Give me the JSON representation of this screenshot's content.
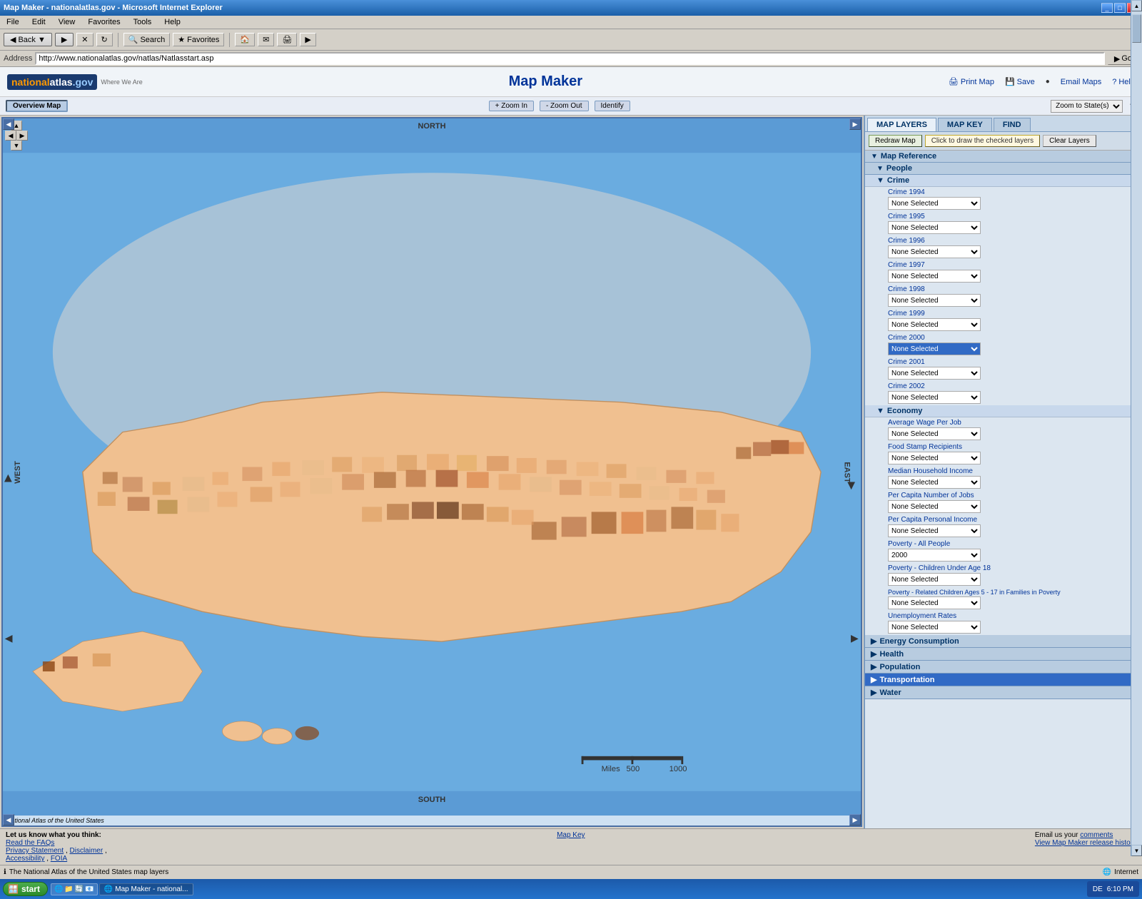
{
  "browser": {
    "title": "Map Maker - nationalatlas.gov - Microsoft Internet Explorer",
    "address": "http://www.nationalatlas.gov/natlas/Natlasstart.asp",
    "menu": [
      "File",
      "Edit",
      "View",
      "Favorites",
      "Tools",
      "Help"
    ],
    "back_label": "Back",
    "forward_label": "▶",
    "search_label": "Search",
    "favorites_label": "Favorites",
    "go_label": "Go",
    "address_label": "Address"
  },
  "app": {
    "logo_name": "nationalatlas.gov",
    "logo_sub": "Where We Are",
    "title": "Map Maker",
    "print_map": "Print Map",
    "save_label": "Save",
    "email_maps": "Email Maps",
    "help_label": "Help"
  },
  "map_toolbar": {
    "overview_map": "Overview Map",
    "zoom_in": "+ Zoom In",
    "zoom_out": "- Zoom Out",
    "identify": "Identify",
    "zoom_to": "Zoom to State(s)",
    "north": "NORTH",
    "south": "SOUTH",
    "west": "WEST",
    "east": "EAST",
    "miles_label": "Miles",
    "atlas_credit": "National Atlas of the United States"
  },
  "right_panel": {
    "tabs": [
      "MAP LAYERS",
      "MAP KEY",
      "FIND"
    ],
    "active_tab": "MAP LAYERS",
    "redraw_btn": "Redraw Map",
    "click_draw_btn": "Click to draw the checked layers",
    "clear_btn": "Clear Layers",
    "map_reference": "Map Reference",
    "sections": {
      "people": {
        "label": "People",
        "expanded": true,
        "categories": {
          "crime": {
            "label": "Crime",
            "expanded": true,
            "items": [
              {
                "label": "Crime 1994",
                "value": "None Selected",
                "highlighted": false
              },
              {
                "label": "Crime 1995",
                "value": "None Selected",
                "highlighted": false
              },
              {
                "label": "Crime 1996",
                "value": "None Selected",
                "highlighted": false
              },
              {
                "label": "Crime 1997",
                "value": "None Selected",
                "highlighted": false
              },
              {
                "label": "Crime 1998",
                "value": "None Selected",
                "highlighted": false
              },
              {
                "label": "Crime 1999",
                "value": "None Selected",
                "highlighted": false
              },
              {
                "label": "Crime 2000",
                "value": "None Selected",
                "highlighted": true
              },
              {
                "label": "Crime 2001",
                "value": "None Selected",
                "highlighted": false
              },
              {
                "label": "Crime 2002",
                "value": "None Selected",
                "highlighted": false
              }
            ]
          },
          "economy": {
            "label": "Economy",
            "expanded": true,
            "items": [
              {
                "label": "Average Wage Per Job",
                "value": "None Selected",
                "highlighted": false
              },
              {
                "label": "Food Stamp Recipients",
                "value": "None Selected",
                "highlighted": false
              },
              {
                "label": "Median Household Income",
                "value": "None Selected",
                "highlighted": false
              },
              {
                "label": "Per Capita Number of Jobs",
                "value": "None Selected",
                "highlighted": false
              },
              {
                "label": "Per Capita Personal Income",
                "value": "None Selected",
                "highlighted": false
              },
              {
                "label": "Poverty - All People",
                "value": "2000",
                "highlighted": false
              },
              {
                "label": "Poverty - Children Under Age 18",
                "value": "None Selected",
                "highlighted": false
              },
              {
                "label": "Poverty - Related Children Ages 5 - 17 in Families in Poverty",
                "value": "None Selected",
                "highlighted": false
              },
              {
                "label": "Unemployment Rates",
                "value": "None Selected",
                "highlighted": false
              }
            ]
          }
        }
      },
      "energy_consumption": {
        "label": "Energy Consumption",
        "expanded": false
      },
      "health": {
        "label": "Health",
        "expanded": false
      },
      "population": {
        "label": "Population",
        "expanded": false
      },
      "transportation": {
        "label": "Transportation",
        "expanded": false,
        "highlighted": true
      },
      "water": {
        "label": "Water",
        "expanded": false
      }
    }
  },
  "footer": {
    "feedback": "Let us know what you think:",
    "read_faqs": "Read the FAQs",
    "privacy": "Privacy Statement",
    "disclaimer": "Disclaimer",
    "accessibility": "Accessibility",
    "foia": "FOIA",
    "map_key": "Map Key",
    "email_comments": "Email us your comments",
    "view_history": "View Map Maker release history"
  },
  "status_bar": {
    "status_text": "The National Atlas of the United States map layers",
    "zone": "Internet",
    "time": "6:10 PM"
  },
  "taskbar": {
    "start": "start",
    "items": [
      {
        "label": "Map Maker - national...",
        "active": true
      }
    ],
    "tray_items": [
      "DE"
    ]
  }
}
